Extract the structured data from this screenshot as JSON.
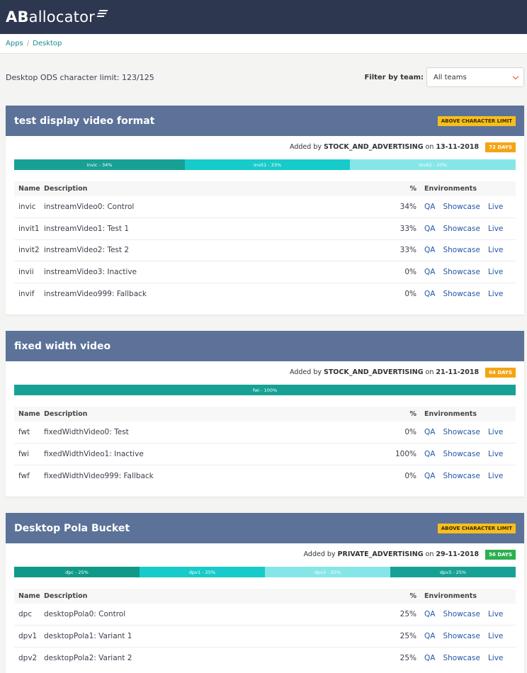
{
  "app": {
    "logo_bold": "AB",
    "logo_light": "allocator"
  },
  "breadcrumb": {
    "apps": "Apps",
    "sep": "/",
    "current": "Desktop"
  },
  "toolbar": {
    "limit_text": "Desktop ODS character limit: 123/125",
    "filter_label": "Filter by team:",
    "filter_value": "All teams"
  },
  "table_headers": {
    "name": "Name",
    "description": "Description",
    "pct": "%",
    "environments": "Environments"
  },
  "env_labels": {
    "qa": "QA",
    "showcase": "Showcase",
    "live": "Live"
  },
  "colors": {
    "header": "#2e3750",
    "card_head": "#5c7298",
    "limit_badge": "#f6be1e",
    "days_orange": "#f5a413",
    "days_green": "#2bb04e",
    "link": "#2456a6"
  },
  "tests": [
    {
      "title": "test display video format",
      "limit_badge": "ABOVE CHARACTER LIMIT",
      "added_prefix": "Added by",
      "added_by": "STOCK_AND_ADVERTISING",
      "added_on": "on",
      "date": "13-11-2018",
      "days": "72 DAYS",
      "days_color": "orange",
      "allocation": [
        {
          "label": "invic - 34%",
          "value": 34,
          "color": "c1"
        },
        {
          "label": "invit1 - 33%",
          "value": 33,
          "color": "c2"
        },
        {
          "label": "invit2 - 33%",
          "value": 33,
          "color": "c3"
        }
      ],
      "rows": [
        {
          "name": "invic",
          "description": "instreamVideo0: Control",
          "pct": "34%"
        },
        {
          "name": "invit1",
          "description": "instreamVideo1: Test 1",
          "pct": "33%"
        },
        {
          "name": "invit2",
          "description": "instreamVideo2: Test 2",
          "pct": "33%"
        },
        {
          "name": "invii",
          "description": "instreamVideo3: Inactive",
          "pct": "0%"
        },
        {
          "name": "invif",
          "description": "instreamVideo999: Fallback",
          "pct": "0%"
        }
      ]
    },
    {
      "title": "fixed width video",
      "limit_badge": "",
      "added_prefix": "Added by",
      "added_by": "STOCK_AND_ADVERTISING",
      "added_on": "on",
      "date": "21-11-2018",
      "days": "64 DAYS",
      "days_color": "orange",
      "allocation": [
        {
          "label": "fwi - 100%",
          "value": 100,
          "color": "c1"
        }
      ],
      "rows": [
        {
          "name": "fwt",
          "description": "fixedWidthVideo0: Test",
          "pct": "0%"
        },
        {
          "name": "fwi",
          "description": "fixedWidthVideo1: Inactive",
          "pct": "100%"
        },
        {
          "name": "fwf",
          "description": "fixedWidthVideo999: Fallback",
          "pct": "0%"
        }
      ]
    },
    {
      "title": "Desktop Pola Bucket",
      "limit_badge": "ABOVE CHARACTER LIMIT",
      "added_prefix": "Added by",
      "added_by": "PRIVATE_ADVERTISING",
      "added_on": "on",
      "date": "29-11-2018",
      "days": "56 DAYS",
      "days_color": "green",
      "allocation": [
        {
          "label": "dpc - 25%",
          "value": 25,
          "color": "c4"
        },
        {
          "label": "dpv1 - 25%",
          "value": 25,
          "color": "c2"
        },
        {
          "label": "dpv2 - 25%",
          "value": 25,
          "color": "c3"
        },
        {
          "label": "dpv3 - 25%",
          "value": 25,
          "color": "c1"
        }
      ],
      "rows": [
        {
          "name": "dpc",
          "description": "desktopPola0: Control",
          "pct": "25%"
        },
        {
          "name": "dpv1",
          "description": "desktopPola1: Variant 1",
          "pct": "25%"
        },
        {
          "name": "dpv2",
          "description": "desktopPola2: Variant 2",
          "pct": "25%"
        }
      ]
    }
  ]
}
